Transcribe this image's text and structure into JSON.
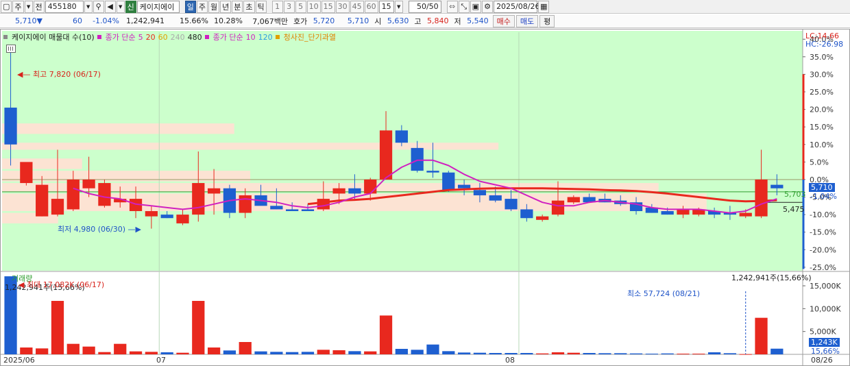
{
  "toolbar": {
    "period_selected": "주",
    "prev_label": "전",
    "code": "455180",
    "new_badge": "신",
    "stock_name": "케이지에이",
    "period_tabs": [
      "일",
      "주",
      "월",
      "년",
      "분",
      "초",
      "틱"
    ],
    "active_period": "일",
    "minute_options": [
      "1",
      "3",
      "5",
      "10",
      "15",
      "30",
      "45",
      "60"
    ],
    "count_select": "15",
    "bar_count": "50/50",
    "date": "2025/08/26"
  },
  "quote": {
    "price": "5,710",
    "change_arrow": "▼",
    "change": "60",
    "change_pct": "-1.04%",
    "volume": "1,242,941",
    "turnover_pct": "15.66%",
    "rate": "10.28%",
    "amount": "7,067백만",
    "hoga_label": "호가",
    "ask": "5,720",
    "bid": "5,710",
    "open_label": "시",
    "open": "5,630",
    "high_label": "고",
    "high": "5,840",
    "low_label": "저",
    "low": "5,540",
    "buy_label": "매수",
    "sell_label": "매도",
    "eval_label": "평"
  },
  "legend": {
    "chart_title": "케이지에이 매물대 수(10)",
    "ma_price_label": "종가 단순",
    "ma_price_periods": [
      "5",
      "20",
      "60",
      "240",
      "480"
    ],
    "ma_price_colors": [
      "#d020c0",
      "#e8281e",
      "#e0a000",
      "#aaaaaa",
      "#222222"
    ],
    "ma_vol_label": "종가 단순",
    "ma_vol_periods": [
      "10",
      "120"
    ],
    "ma_vol_colors": [
      "#d020c0",
      "#2e9de0"
    ],
    "signal_label": "청사진_단기과열"
  },
  "price_annotations": {
    "high_text": "최고 7,820 (06/17)",
    "low_text": "최저 4,980 (06/30)",
    "lc": "LC:14.66",
    "hc": "HC:-26.98",
    "current_price_tag": "5,710",
    "current_pct_tag": "-1.04%",
    "ref_5703": "5,703",
    "ref_5475": "5,475"
  },
  "volume_annotations": {
    "title": "거래량",
    "max_text": "최대 17,082K (06/17)",
    "current_text": "1,242,941주(15,66%)",
    "current_text_right": "1,242,941주(15,66%)",
    "min_text": "최소 57,724 (08/21)",
    "vol_tag": "1,243K",
    "pct_tag": "15,66%"
  },
  "x_axis": {
    "labels": [
      "2025/06",
      "07",
      "08",
      "08/26"
    ]
  },
  "chart_data": {
    "type": "candlestick",
    "title": "케이지에이 매물대 수(10)",
    "y_axis_pct_ticks": [
      "40.0%",
      "35.0%",
      "30.0%",
      "25.0%",
      "20.0%",
      "15.0%",
      "10.0%",
      "5.0%",
      "0.0%",
      "-5.0%",
      "-10.0%",
      "-15.0%",
      "-20.0%",
      "-25.0%"
    ],
    "y_pct_range": [
      -26.0,
      42.0
    ],
    "volume_ticks": [
      "15,000K",
      "10,000K",
      "5,000K"
    ],
    "volume_tick_values": [
      15000,
      10000,
      5000
    ],
    "volume_range": [
      0,
      18000
    ],
    "reference_pct": 0,
    "candles": [
      {
        "o": 20.5,
        "h": 36.6,
        "l": 4.0,
        "c": 10.0
      },
      {
        "o": -1.0,
        "h": 2.0,
        "l": -1.7,
        "c": 5.0
      },
      {
        "o": -10.5,
        "h": 1.0,
        "l": -10.5,
        "c": -1.5
      },
      {
        "o": -10.0,
        "h": 8.5,
        "l": -10.5,
        "c": -5.5
      },
      {
        "o": -8.5,
        "h": 2.5,
        "l": -9.0,
        "c": 0.0
      },
      {
        "o": -2.5,
        "h": 6.5,
        "l": -5.0,
        "c": 0.0
      },
      {
        "o": -7.5,
        "h": 0.0,
        "l": -8.0,
        "c": -1.0
      },
      {
        "o": -6.5,
        "h": -2.0,
        "l": -8.0,
        "c": -5.5
      },
      {
        "o": -9.0,
        "h": -2.0,
        "l": -11.0,
        "c": -5.5
      },
      {
        "o": -10.5,
        "h": -7.5,
        "l": -14.0,
        "c": -9.0
      },
      {
        "o": -10.0,
        "h": -9.0,
        "l": -11.0,
        "c": -11.0
      },
      {
        "o": -12.5,
        "h": -8.5,
        "l": -13.0,
        "c": -10.0
      },
      {
        "o": -10.0,
        "h": 8.0,
        "l": -12.0,
        "c": -1.0
      },
      {
        "o": -4.0,
        "h": 3.0,
        "l": -10.0,
        "c": -2.5
      },
      {
        "o": -2.5,
        "h": -1.5,
        "l": -11.0,
        "c": -9.5
      },
      {
        "o": -9.5,
        "h": -2.5,
        "l": -11.0,
        "c": -4.5
      },
      {
        "o": -4.5,
        "h": -1.5,
        "l": -7.0,
        "c": -7.5
      },
      {
        "o": -7.5,
        "h": -2.5,
        "l": -8.5,
        "c": -8.5
      },
      {
        "o": -8.5,
        "h": -6.5,
        "l": -9.0,
        "c": -9.0
      },
      {
        "o": -8.5,
        "h": -7.0,
        "l": -9.0,
        "c": -9.0
      },
      {
        "o": -8.5,
        "h": -0.5,
        "l": -9.0,
        "c": -5.5
      },
      {
        "o": -4.0,
        "h": -1.0,
        "l": -7.0,
        "c": -2.5
      },
      {
        "o": -2.5,
        "h": 1.5,
        "l": -5.5,
        "c": -4.0
      },
      {
        "o": -4.0,
        "h": 0.5,
        "l": -6.0,
        "c": 0.0
      },
      {
        "o": 0.0,
        "h": 19.5,
        "l": 0.0,
        "c": 14.0
      },
      {
        "o": 14.0,
        "h": 15.5,
        "l": 9.5,
        "c": 10.5
      },
      {
        "o": 9.0,
        "h": 11.0,
        "l": 2.0,
        "c": 2.5
      },
      {
        "o": 2.5,
        "h": 10.5,
        "l": 0.5,
        "c": 2.0
      },
      {
        "o": 2.0,
        "h": 2.5,
        "l": -3.5,
        "c": -3.0
      },
      {
        "o": -1.5,
        "h": 0.0,
        "l": -4.5,
        "c": -2.5
      },
      {
        "o": -3.0,
        "h": -1.0,
        "l": -6.5,
        "c": -4.5
      },
      {
        "o": -4.5,
        "h": -2.0,
        "l": -6.5,
        "c": -6.0
      },
      {
        "o": -5.5,
        "h": -3.0,
        "l": -9.0,
        "c": -8.5
      },
      {
        "o": -8.5,
        "h": -7.0,
        "l": -12.0,
        "c": -11.0
      },
      {
        "o": -11.5,
        "h": -10.0,
        "l": -12.0,
        "c": -10.5
      },
      {
        "o": -10.0,
        "h": -0.5,
        "l": -10.5,
        "c": -6.0
      },
      {
        "o": -6.5,
        "h": -4.5,
        "l": -7.0,
        "c": -5.0
      },
      {
        "o": -5.0,
        "h": -4.0,
        "l": -6.5,
        "c": -6.5
      },
      {
        "o": -5.5,
        "h": -4.0,
        "l": -6.5,
        "c": -6.5
      },
      {
        "o": -6.0,
        "h": -4.5,
        "l": -7.5,
        "c": -7.0
      },
      {
        "o": -6.5,
        "h": -5.0,
        "l": -10.0,
        "c": -9.0
      },
      {
        "o": -8.0,
        "h": -7.0,
        "l": -9.5,
        "c": -9.5
      },
      {
        "o": -9.0,
        "h": -8.0,
        "l": -10.0,
        "c": -10.0
      },
      {
        "o": -10.0,
        "h": -7.5,
        "l": -11.0,
        "c": -8.5
      },
      {
        "o": -10.0,
        "h": -8.0,
        "l": -10.5,
        "c": -8.5
      },
      {
        "o": -9.0,
        "h": -8.0,
        "l": -11.0,
        "c": -10.0
      },
      {
        "o": -9.5,
        "h": -7.5,
        "l": -11.5,
        "c": -10.0
      },
      {
        "o": -10.5,
        "h": -8.5,
        "l": -11.0,
        "c": -9.5
      },
      {
        "o": -10.5,
        "h": 8.5,
        "l": -11.0,
        "c": 0.0
      },
      {
        "o": -1.5,
        "h": 1.5,
        "l": -4.5,
        "c": -2.5
      }
    ],
    "volumes": [
      17082,
      1500,
      1300,
      11700,
      2300,
      1700,
      500,
      2300,
      650,
      550,
      450,
      350,
      11700,
      1500,
      850,
      2700,
      650,
      550,
      500,
      550,
      1000,
      900,
      700,
      650,
      8500,
      1200,
      1000,
      2150,
      700,
      400,
      350,
      300,
      300,
      300,
      200,
      450,
      350,
      300,
      250,
      250,
      200,
      150,
      200,
      150,
      150,
      450,
      250,
      58,
      8000,
      1243
    ],
    "ma_purple": [
      null,
      null,
      null,
      null,
      -2.5,
      -4.0,
      -5.0,
      -5.5,
      -7.0,
      -7.5,
      -8.0,
      -8.5,
      -8.0,
      -7.0,
      -6.0,
      -5.5,
      -6.0,
      -6.5,
      -7.5,
      -8.0,
      -7.5,
      -6.5,
      -5.0,
      -4.0,
      0.5,
      3.5,
      5.5,
      5.5,
      4.0,
      1.5,
      -0.5,
      -1.5,
      -2.5,
      -4.5,
      -6.5,
      -7.5,
      -7.5,
      -6.5,
      -6.0,
      -6.5,
      -7.0,
      -8.0,
      -8.5,
      -8.5,
      -8.5,
      -9.0,
      -9.5,
      -9.0,
      -7.0,
      -5.5
    ],
    "ma_red": [
      null,
      null,
      null,
      null,
      null,
      null,
      null,
      null,
      null,
      null,
      null,
      null,
      null,
      null,
      null,
      null,
      null,
      null,
      null,
      -7.0,
      -6.5,
      -6.0,
      -5.8,
      -5.5,
      -5.0,
      -4.5,
      -4.0,
      -3.5,
      -3.0,
      -2.8,
      -2.6,
      -2.5,
      -2.5,
      -2.5,
      -2.5,
      -2.6,
      -2.7,
      -2.8,
      -3.0,
      -3.1,
      -3.3,
      -3.6,
      -4.0,
      -4.5,
      -5.0,
      -5.5,
      -6.0,
      -6.2,
      -6.1,
      -5.9
    ],
    "x_labels": [
      {
        "label": "2025/06",
        "index": 0
      },
      {
        "label": "07",
        "index": 10
      },
      {
        "label": "08",
        "index": 33
      },
      {
        "label": "08/26",
        "index": 50
      }
    ],
    "volume_profile": [
      {
        "from": 16.0,
        "to": 13.0,
        "len": 0.29
      },
      {
        "from": 10.5,
        "to": 8.5,
        "len": 0.62
      },
      {
        "from": 6.0,
        "to": 3.0,
        "len": 0.1
      },
      {
        "from": 2.5,
        "to": -0.5,
        "len": 0.31
      },
      {
        "from": -1.0,
        "to": -3.5,
        "len": 0.82
      },
      {
        "from": -4.0,
        "to": -9.0,
        "len": 0.88
      },
      {
        "from": -9.5,
        "to": -12.5,
        "len": 0.07
      }
    ],
    "colors": {
      "up": "#e8281e",
      "down": "#1e5fd0",
      "bg": "#ccffcc",
      "profile": "#fce3d3"
    }
  }
}
